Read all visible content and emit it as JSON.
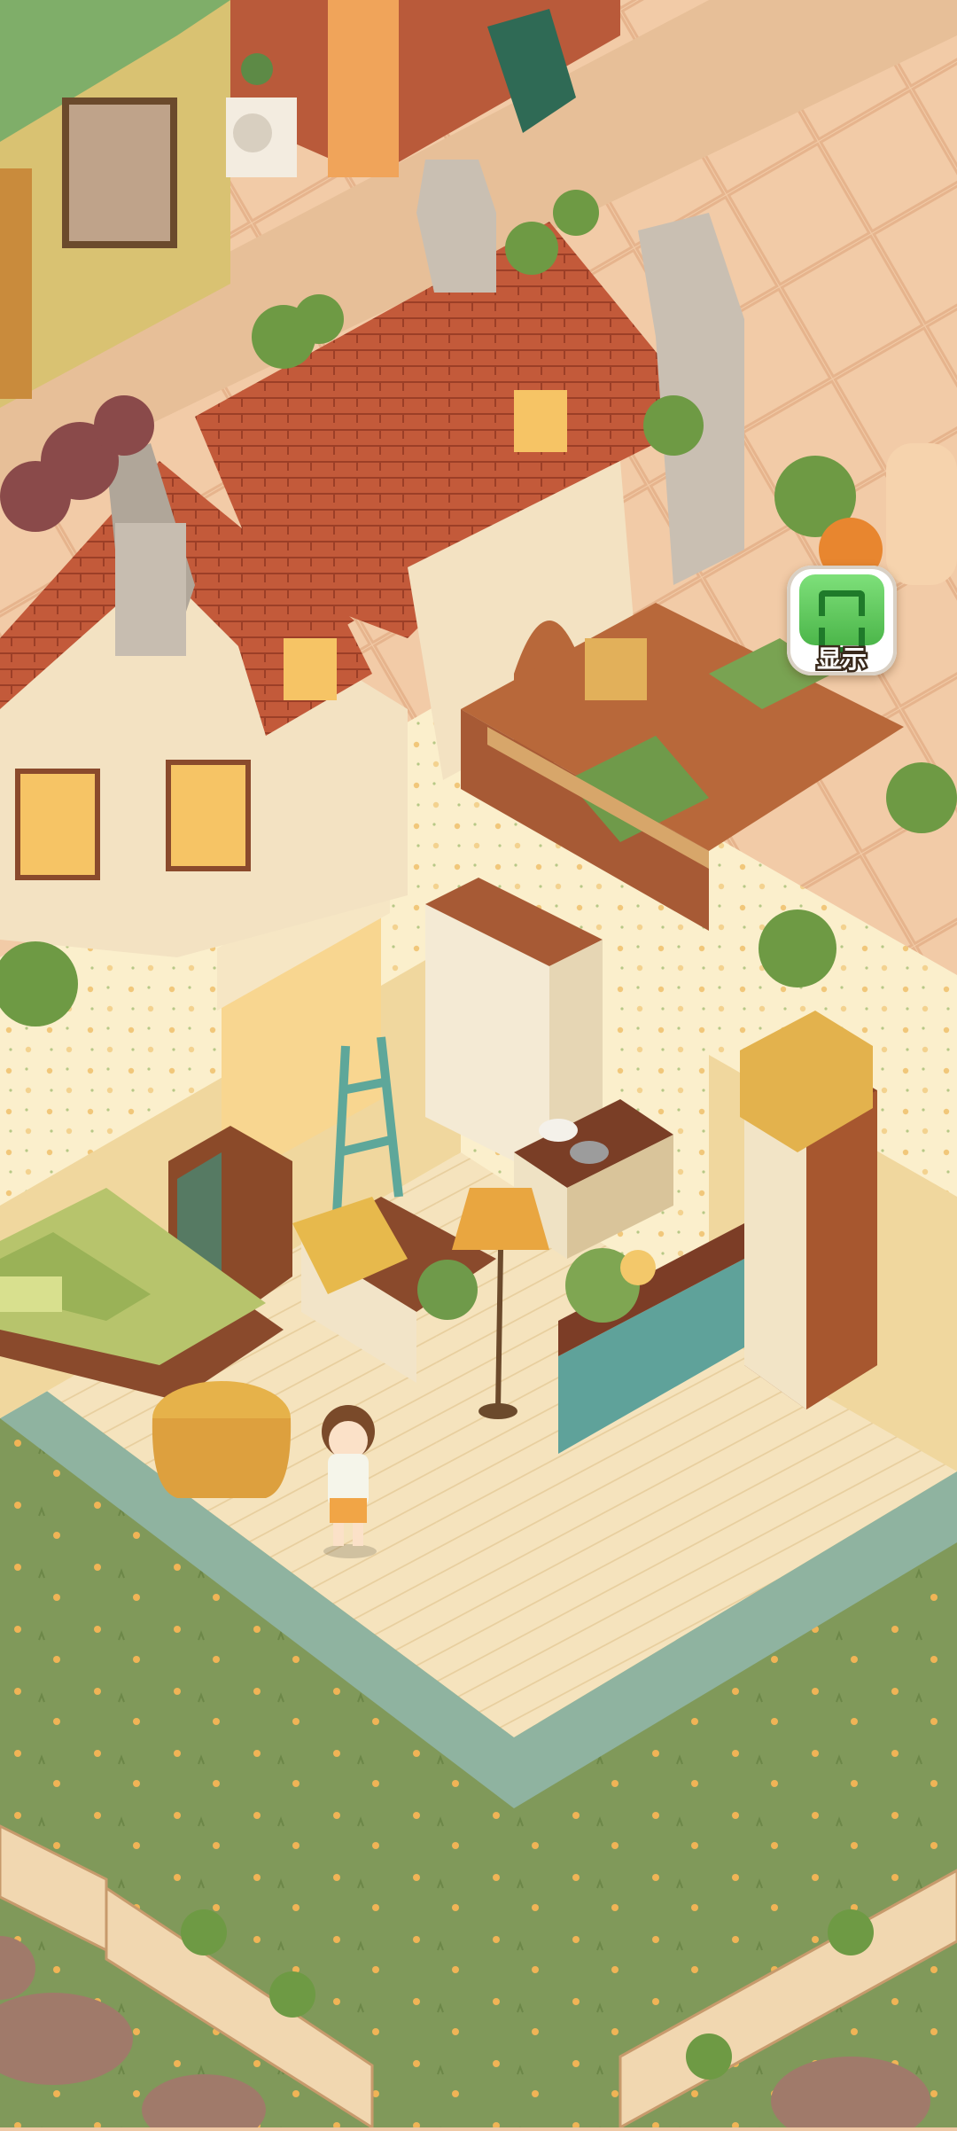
{
  "hud": {
    "show_button_label": "显示",
    "show_button_icon": "view-frame-icon"
  },
  "colors": {
    "street": "#f0c9a6",
    "lawn": "#7f9a56",
    "floor": "#f6e6c2",
    "wallpaper": "#fbf0cf",
    "roof": "#c0583a",
    "button_green": "#5cc75a"
  }
}
